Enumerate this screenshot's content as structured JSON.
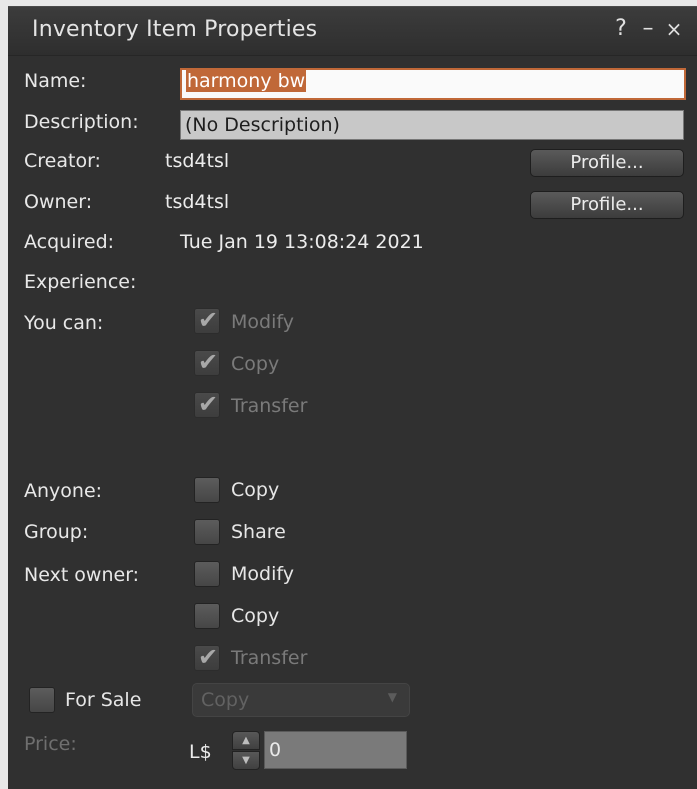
{
  "window": {
    "title": "Inventory Item Properties",
    "help_glyph": "?",
    "minimize_glyph": "–",
    "close_glyph": "×"
  },
  "fields": {
    "name_label": "Name:",
    "name_value": "harmony bw",
    "description_label": "Description:",
    "description_value": "(No Description)",
    "creator_label": "Creator:",
    "creator_value": "tsd4tsl",
    "owner_label": "Owner:",
    "owner_value": "tsd4tsl",
    "profile_button": "Profile...",
    "acquired_label": "Acquired:",
    "acquired_value": "Tue Jan 19 13:08:24 2021",
    "experience_label": "Experience:"
  },
  "permissions": {
    "you_can_label": "You can:",
    "you_can": [
      {
        "label": "Modify",
        "checked": true,
        "enabled": false
      },
      {
        "label": "Copy",
        "checked": true,
        "enabled": false
      },
      {
        "label": "Transfer",
        "checked": true,
        "enabled": false
      }
    ],
    "anyone_label": "Anyone:",
    "anyone_copy": {
      "label": "Copy",
      "checked": false,
      "enabled": true
    },
    "group_label": "Group:",
    "group_share": {
      "label": "Share",
      "checked": false,
      "enabled": true
    },
    "next_owner_label": "Next owner:",
    "next_owner": [
      {
        "label": "Modify",
        "checked": false,
        "enabled": true
      },
      {
        "label": "Copy",
        "checked": false,
        "enabled": true
      },
      {
        "label": "Transfer",
        "checked": true,
        "enabled": false
      }
    ]
  },
  "sale": {
    "for_sale_label": "For Sale",
    "for_sale_checked": false,
    "sale_type_selected": "Copy",
    "price_label": "Price:",
    "currency": "L$",
    "price_value": "0"
  },
  "icons": {
    "checkmark": "✔",
    "dropdown": "▼",
    "spin_up": "▲",
    "spin_down": "▼"
  },
  "colors": {
    "background": "#303030",
    "accent": "#c06838",
    "text": "#e8e8e8",
    "disabled_text": "#7a7a7a"
  }
}
